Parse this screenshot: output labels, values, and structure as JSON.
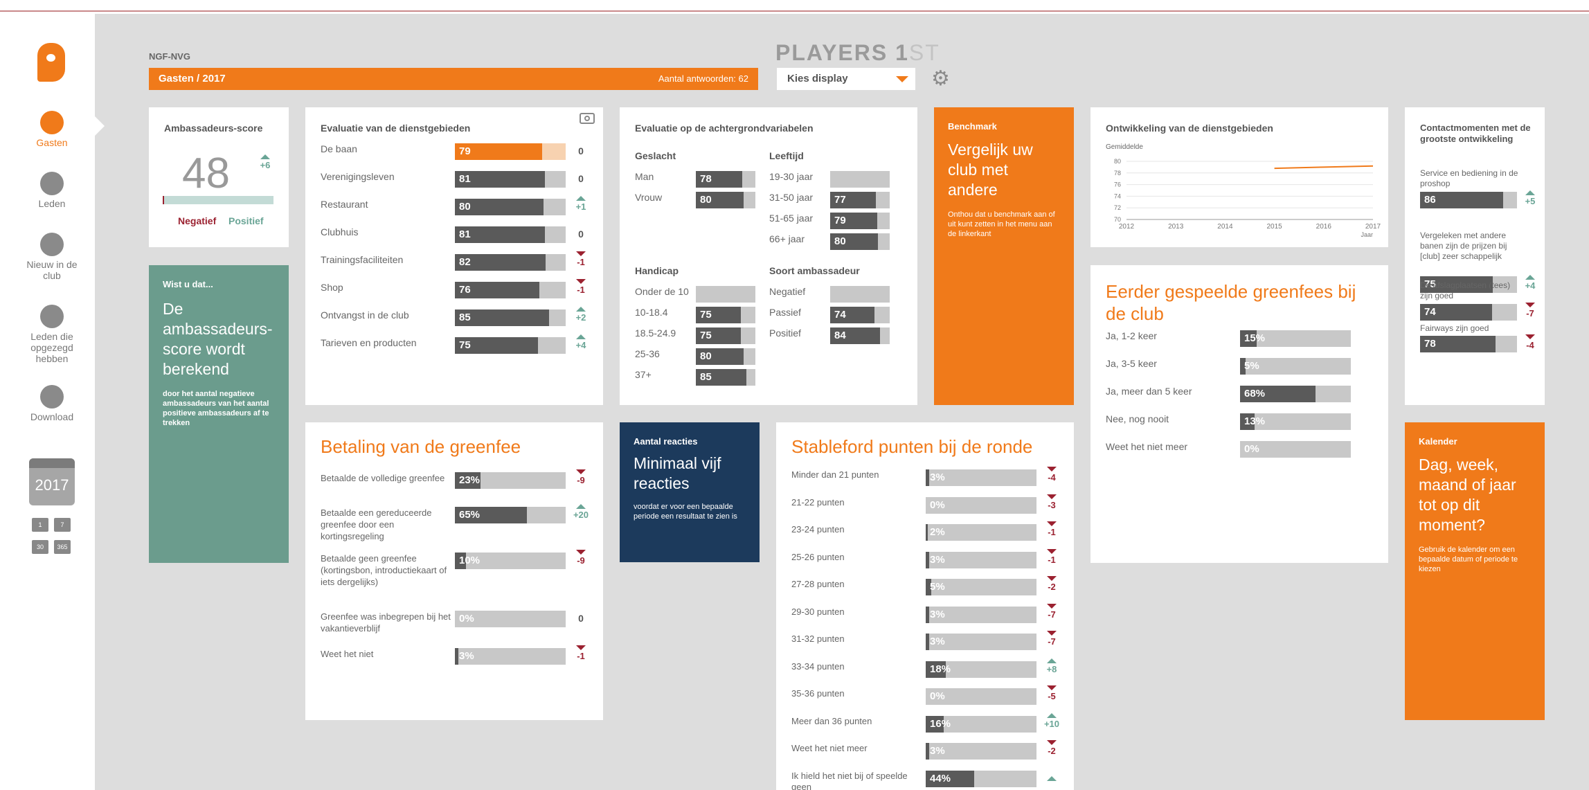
{
  "app": {
    "org": "NGF-NVG",
    "brand_main": "PLAYERS 1",
    "brand_st": "ST",
    "section": "Gasten / 2017",
    "answers": "Aantal antwoorden: 62",
    "display_select": "Kies display"
  },
  "nav": [
    {
      "label": "Gasten",
      "icon": "guest-icon"
    },
    {
      "label": "Leden",
      "icon": "members-icon"
    },
    {
      "label": "Nieuw in de club",
      "icon": "plus-icon"
    },
    {
      "label": "Leden die opgezegd hebben",
      "icon": "divide-icon"
    },
    {
      "label": "Download",
      "icon": "download-icon"
    }
  ],
  "calendar": {
    "year": "2017",
    "buttons": [
      "1",
      "7",
      "30",
      "365"
    ]
  },
  "ambassador": {
    "title": "Ambassadeurs-score",
    "score": "48",
    "change": "+6",
    "neg": "Negatief",
    "pos": "Positief"
  },
  "witu": {
    "title": "Wist u dat...",
    "heading": "De ambassadeurs-score wordt berekend",
    "text": "door het aantal negatieve ambassadeurs van het aantal positieve ambassadeurs af te trekken"
  },
  "eval": {
    "title": "Evaluatie van de dienstgebieden",
    "rows": [
      {
        "label": "De baan",
        "value": 79,
        "change": "0",
        "dir": "z",
        "hl": true
      },
      {
        "label": "Verenigingsleven",
        "value": 81,
        "change": "0",
        "dir": "z"
      },
      {
        "label": "Restaurant",
        "value": 80,
        "change": "+1",
        "dir": "u"
      },
      {
        "label": "Clubhuis",
        "value": 81,
        "change": "0",
        "dir": "z"
      },
      {
        "label": "Trainingsfaciliteiten",
        "value": 82,
        "change": "-1",
        "dir": "d"
      },
      {
        "label": "Shop",
        "value": 76,
        "change": "-1",
        "dir": "d"
      },
      {
        "label": "Ontvangst in de club",
        "value": 85,
        "change": "+2",
        "dir": "u"
      },
      {
        "label": "Tarieven en producten",
        "value": 75,
        "change": "+4",
        "dir": "u"
      }
    ]
  },
  "bg": {
    "title": "Evaluatie op de achtergrondvariabelen",
    "geslacht": {
      "title": "Geslacht",
      "rows": [
        {
          "label": "Man",
          "value": 78
        },
        {
          "label": "Vrouw",
          "value": 80
        }
      ]
    },
    "leeftijd": {
      "title": "Leeftijd",
      "rows": [
        {
          "label": "19-30 jaar",
          "value": null
        },
        {
          "label": "31-50 jaar",
          "value": 77
        },
        {
          "label": "51-65 jaar",
          "value": 79
        },
        {
          "label": "66+ jaar",
          "value": 80
        }
      ]
    },
    "handicap": {
      "title": "Handicap",
      "rows": [
        {
          "label": "Onder de 10",
          "value": null
        },
        {
          "label": "10-18.4",
          "value": 75
        },
        {
          "label": "18.5-24.9",
          "value": 75
        },
        {
          "label": "25-36",
          "value": 80
        },
        {
          "label": "37+",
          "value": 85
        }
      ]
    },
    "soort": {
      "title": "Soort ambassadeur",
      "rows": [
        {
          "label": "Negatief",
          "value": null
        },
        {
          "label": "Passief",
          "value": 74
        },
        {
          "label": "Positief",
          "value": 84
        }
      ]
    }
  },
  "benchmark": {
    "title": "Benchmark",
    "heading": "Vergelijk uw club met andere",
    "text": "Onthou dat u benchmark aan of uit kunt zetten in het menu aan de linkerkant"
  },
  "ontw": {
    "title": "Ontwikkeling van de dienstgebieden",
    "ylabel": "Gemiddelde",
    "xlabel": "Jaar"
  },
  "chart_data": {
    "type": "line",
    "x": [
      "2012",
      "2013",
      "2014",
      "2015",
      "2016",
      "2017"
    ],
    "ylim": [
      70,
      80
    ],
    "yticks": [
      "70",
      "72",
      "74",
      "76",
      "78",
      "80"
    ],
    "series": [
      {
        "values": [
          null,
          null,
          null,
          78.8,
          79,
          79.2
        ]
      }
    ],
    "xlabel": "Jaar",
    "ylabel": "Gemiddelde",
    "grid": true
  },
  "contact": {
    "title": "Contactmomenten met de grootste ontwikkeling",
    "rows": [
      {
        "label": "Service en bediening in de proshop",
        "value": 86,
        "change": "+5",
        "dir": "u"
      },
      {
        "label": "Vergeleken met andere banen zijn de prijzen bij [club] zeer schappelijk",
        "value": 75,
        "change": "+4",
        "dir": "u"
      },
      {
        "label": "De afslagplaatsen (tees) zijn goed",
        "value": 74,
        "change": "-7",
        "dir": "d"
      },
      {
        "label": "Fairways zijn goed",
        "value": 78,
        "change": "-4",
        "dir": "d"
      }
    ]
  },
  "eerder": {
    "title": "Eerder gespeelde greenfees bij de club",
    "rows": [
      {
        "label": "Ja, 1-2 keer",
        "value": "15%",
        "pct": 15
      },
      {
        "label": "Ja, 3-5 keer",
        "value": "5%",
        "pct": 5
      },
      {
        "label": "Ja, meer dan 5 keer",
        "value": "68%",
        "pct": 68
      },
      {
        "label": "Nee, nog nooit",
        "value": "13%",
        "pct": 13
      },
      {
        "label": "Weet het niet meer",
        "value": "0%",
        "pct": 0
      }
    ]
  },
  "betaling": {
    "title": "Betaling van de greenfee",
    "rows": [
      {
        "label": "Betaalde de volledige greenfee",
        "value": "23%",
        "pct": 23,
        "change": "-9",
        "dir": "d"
      },
      {
        "label": "Betaalde een gereduceerde greenfee door een kortingsregeling",
        "value": "65%",
        "pct": 65,
        "change": "+20",
        "dir": "u"
      },
      {
        "label": "Betaalde geen greenfee (kortingsbon, introductiekaart of iets dergelijks)",
        "value": "10%",
        "pct": 10,
        "change": "-9",
        "dir": "d"
      },
      {
        "label": "Greenfee was inbegrepen bij het vakantieverblijf",
        "value": "0%",
        "pct": 0,
        "change": "0",
        "dir": "z"
      },
      {
        "label": "Weet het niet",
        "value": "3%",
        "pct": 3,
        "change": "-1",
        "dir": "d"
      }
    ]
  },
  "reacties": {
    "title": "Aantal reacties",
    "heading": "Minimaal vijf reacties",
    "text": "voordat er voor een bepaalde periode een resultaat te zien is"
  },
  "stableford": {
    "title": "Stableford punten bij de ronde",
    "rows": [
      {
        "label": "Minder dan 21 punten",
        "value": "3%",
        "pct": 3,
        "change": "-4",
        "dir": "d"
      },
      {
        "label": "21-22 punten",
        "value": "0%",
        "pct": 0,
        "change": "-3",
        "dir": "d"
      },
      {
        "label": "23-24 punten",
        "value": "2%",
        "pct": 2,
        "change": "-1",
        "dir": "d"
      },
      {
        "label": "25-26 punten",
        "value": "3%",
        "pct": 3,
        "change": "-1",
        "dir": "d"
      },
      {
        "label": "27-28 punten",
        "value": "5%",
        "pct": 5,
        "change": "-2",
        "dir": "d"
      },
      {
        "label": "29-30 punten",
        "value": "3%",
        "pct": 3,
        "change": "-7",
        "dir": "d"
      },
      {
        "label": "31-32 punten",
        "value": "3%",
        "pct": 3,
        "change": "-7",
        "dir": "d"
      },
      {
        "label": "33-34 punten",
        "value": "18%",
        "pct": 18,
        "change": "+8",
        "dir": "u"
      },
      {
        "label": "35-36 punten",
        "value": "0%",
        "pct": 0,
        "change": "-5",
        "dir": "d"
      },
      {
        "label": "Meer dan 36 punten",
        "value": "16%",
        "pct": 16,
        "change": "+10",
        "dir": "u"
      },
      {
        "label": "Weet het niet meer",
        "value": "3%",
        "pct": 3,
        "change": "-2",
        "dir": "d"
      },
      {
        "label": "Ik hield het niet bij of speelde geen",
        "value": "44%",
        "pct": 44,
        "change": "",
        "dir": "u"
      }
    ]
  },
  "kalender": {
    "title": "Kalender",
    "heading": "Dag, week, maand of jaar tot op dit moment?",
    "text": "Gebruik de kalender om een bepaalde datum of periode te kiezen"
  }
}
